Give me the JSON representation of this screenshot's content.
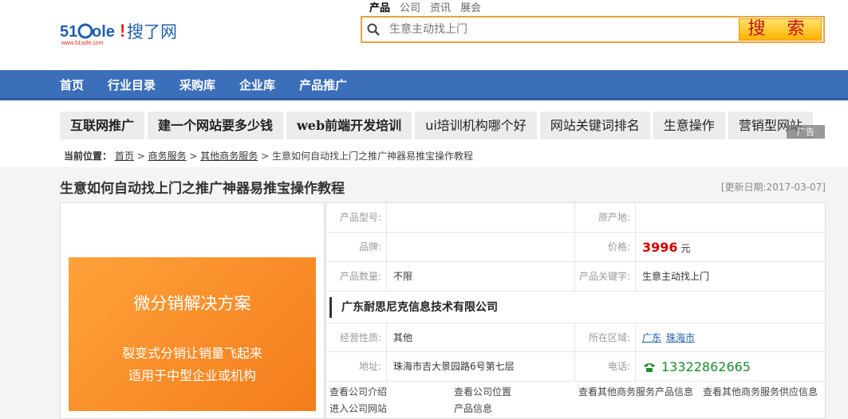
{
  "logo": {
    "brand": "51Sole!",
    "cn": "搜了网",
    "sub": "www.51sole.com"
  },
  "search": {
    "tabs": [
      "产品",
      "公司",
      "资讯",
      "展会"
    ],
    "placeholder": "生意主动找上门",
    "button": "搜 索"
  },
  "nav": [
    "首页",
    "行业目录",
    "采购库",
    "企业库",
    "产品推广"
  ],
  "keywords": [
    "互联网推广",
    "建一个网站要多少钱",
    "web前端开发培训",
    "ui培训机构哪个好",
    "网站关键词排名",
    "生意操作",
    "营销型网站"
  ],
  "ad_label": "广告",
  "breadcrumb": {
    "label": "当前位置：",
    "items": [
      "首页",
      "商务服务",
      "其他商务服务"
    ],
    "current": "生意如何自动找上门之推广神器易推宝操作教程"
  },
  "page": {
    "title": "生意如何自动找上门之推广神器易推宝操作教程",
    "update": "[更新日期:2017-03-07]"
  },
  "promo": {
    "title": "微分销解决方案",
    "line1": "裂变式分销让销量飞起来",
    "line2": "适用于中型企业或机构"
  },
  "info": {
    "model_label": "产品型号:",
    "model_value": "",
    "origin_label": "原产地:",
    "origin_value": "",
    "brand_label": "品牌:",
    "brand_value": "",
    "price_label": "价格:",
    "price_value": "3996",
    "price_unit": "元",
    "qty_label": "产品数量:",
    "qty_value": "不限",
    "kw_label": "产品关键字:",
    "kw_value": "生意主动找上门",
    "company": "广东耐思尼克信息技术有限公司",
    "nature_label": "经营性质:",
    "nature_value": "其他",
    "region_label": "所在区域:",
    "region_province": "广东",
    "region_city": "珠海市",
    "addr_label": "地址:",
    "addr_value": "珠海市吉大景园路6号第七层",
    "phone_label": "电话:",
    "phone_value": "13322862665"
  },
  "links": {
    "intro": "查看公司介绍",
    "location": "查看公司位置",
    "other_products": "查看其他商务服务产品信息",
    "other_suppliers": "查看其他商务服务供应信息",
    "site": "进入公司网站",
    "product_info": "产品信息"
  },
  "colors": {
    "nav": "#3b6fba",
    "accent": "#e8a33b",
    "price": "#d40000",
    "phone": "#1c8a2b",
    "promo": "#f7901e"
  }
}
